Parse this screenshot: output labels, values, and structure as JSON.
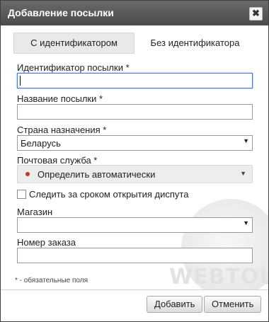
{
  "dialog": {
    "title": "Добавление посылки",
    "close_symbol": "✖"
  },
  "tabs": [
    {
      "label": "С идентификатором",
      "active": true
    },
    {
      "label": "Без идентификатора",
      "active": false
    }
  ],
  "fields": {
    "tracking_id": {
      "label": "Идентификатор посылки *",
      "value": ""
    },
    "package_name": {
      "label": "Название посылки *",
      "value": ""
    },
    "destination_country": {
      "label": "Страна назначения *",
      "value": "Беларусь"
    },
    "postal_service": {
      "label": "Почтовая служба *",
      "value": "Определить автоматически"
    },
    "dispute_checkbox": {
      "label": "Следить за сроком открытия диспута",
      "checked": false
    },
    "store": {
      "label": "Магазин",
      "value": ""
    },
    "order_number": {
      "label": "Номер заказа",
      "value": ""
    }
  },
  "note": "* - обязательные поля",
  "buttons": {
    "add": "Добавить",
    "cancel": "Отменить"
  },
  "watermark": "WEBTOUS.RU",
  "colors": {
    "titlebar": "#5a5a5a",
    "focus_border": "#4a7bd0",
    "status_dot": "#c0392b"
  }
}
